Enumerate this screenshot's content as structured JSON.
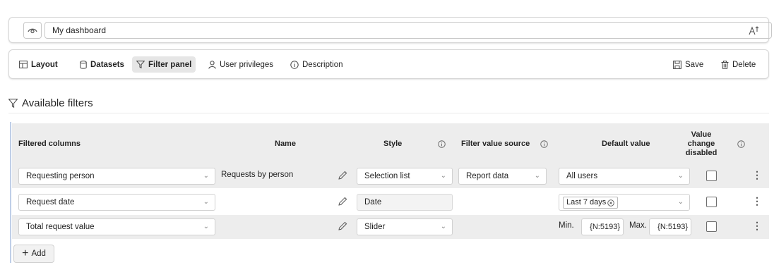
{
  "title_card": {
    "dashboard_name": "My dashboard"
  },
  "toolbar": {
    "layout_label": "Layout",
    "datasets_label": "Datasets",
    "filter_panel_label": "Filter panel",
    "user_privileges_label": "User privileges",
    "description_label": "Description",
    "save_label": "Save",
    "delete_label": "Delete"
  },
  "section": {
    "title": "Available filters"
  },
  "table": {
    "headers": {
      "filtered_columns": "Filtered columns",
      "name": "Name",
      "style": "Style",
      "filter_value_source": "Filter value source",
      "default_value": "Default value",
      "value_change_disabled_line1": "Value",
      "value_change_disabled_line2": "change",
      "value_change_disabled_line3": "disabled"
    },
    "rows": [
      {
        "column": "Requesting person",
        "name": "Requests by person",
        "style": "Selection list",
        "source": "Report data",
        "default": "All users",
        "disabled": false
      },
      {
        "column": "Request date",
        "name": "",
        "style": "Date",
        "source": "",
        "default_chip": "Last 7 days",
        "disabled": false
      },
      {
        "column": "Total request value",
        "name": "",
        "style": "Slider",
        "source": "",
        "min_label": "Min.",
        "min_value": "{N:5193}",
        "max_label": "Max.",
        "max_value": "{N:5193}",
        "disabled": false
      }
    ]
  },
  "add_button": {
    "label": "Add"
  },
  "icons": {
    "visibility": "eye-icon",
    "text_size": "text-size-icon",
    "layout": "layout-icon",
    "datasets": "database-icon",
    "filter": "filter-icon",
    "user": "user-icon",
    "info": "info-icon",
    "save": "save-icon",
    "delete": "trash-icon",
    "edit": "pencil-icon",
    "more": "more-vertical-icon",
    "add": "plus-icon",
    "dropdown": "chevron-down-icon",
    "clear": "clear-circle-icon"
  },
  "colors": {
    "header_bg": "#ededed",
    "accent_bar": "#bfcfe8",
    "active_tab_bg": "#e6e6e6",
    "text": "#242424"
  }
}
